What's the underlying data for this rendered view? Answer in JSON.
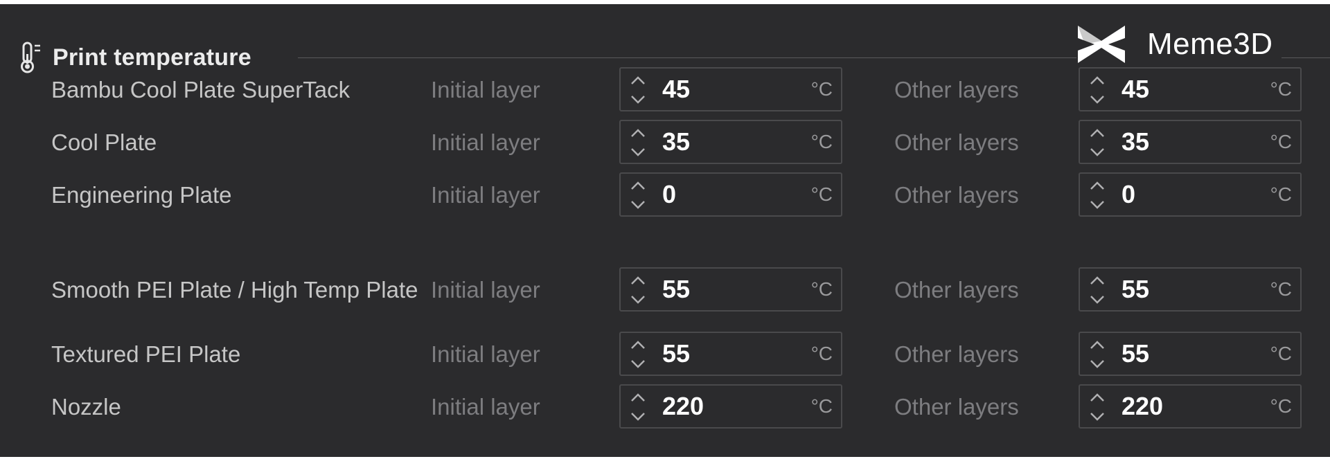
{
  "section": {
    "title": "Print temperature",
    "icon": "thermometer-icon"
  },
  "brand": {
    "name": "Meme3D",
    "logo": "meme3d-logo"
  },
  "labels": {
    "initial": "Initial layer",
    "other": "Other layers",
    "unit": "°C"
  },
  "rows": [
    {
      "name": "Bambu Cool Plate SuperTack",
      "initial": "45",
      "other": "45"
    },
    {
      "name": "Cool Plate",
      "initial": "35",
      "other": "35"
    },
    {
      "name": "Engineering Plate",
      "initial": "0",
      "other": "0"
    },
    {
      "name": "Smooth PEI Plate / High Temp Plate",
      "initial": "55",
      "other": "55"
    },
    {
      "name": "Textured PEI Plate",
      "initial": "55",
      "other": "55"
    },
    {
      "name": "Nozzle",
      "initial": "220",
      "other": "220"
    }
  ]
}
